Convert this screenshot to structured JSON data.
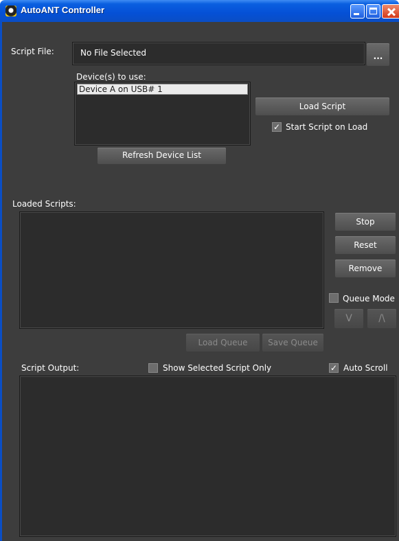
{
  "window": {
    "title": "AutoANT Controller"
  },
  "script_file": {
    "label": "Script File:",
    "value": "No File Selected",
    "browse_label": "..."
  },
  "devices": {
    "label": "Device(s) to use:",
    "items": [
      "Device A on USB# 1"
    ],
    "refresh_label": "Refresh Device List"
  },
  "load": {
    "load_script_label": "Load Script",
    "start_on_load_label": "Start Script on Load",
    "start_on_load_checked": true
  },
  "loaded_scripts": {
    "label": "Loaded Scripts:",
    "stop_label": "Stop",
    "reset_label": "Reset",
    "remove_label": "Remove",
    "queue_mode_label": "Queue Mode",
    "queue_mode_checked": false,
    "down_label": "V",
    "up_label": "/\\",
    "load_queue_label": "Load Queue",
    "save_queue_label": "Save Queue"
  },
  "output": {
    "label": "Script Output:",
    "show_selected_label": "Show Selected Script Only",
    "show_selected_checked": false,
    "auto_scroll_label": "Auto Scroll",
    "auto_scroll_checked": true
  },
  "colors": {
    "titlebar": "#0550d6",
    "panel": "#3d3d3d",
    "field": "#2c2c2c",
    "selection": "#ebebeb"
  }
}
